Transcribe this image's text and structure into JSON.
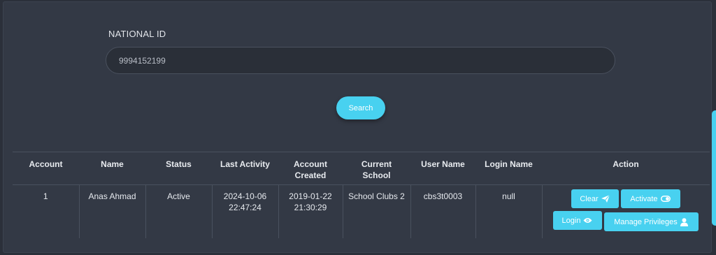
{
  "form": {
    "national_id_label": "NATIONAL ID",
    "national_id_value": "9994152199",
    "search_label": "Search"
  },
  "table": {
    "headers": {
      "account": "Account",
      "name": "Name",
      "status": "Status",
      "last_activity": "Last Activity",
      "account_created_1": "Account",
      "account_created_2": "Created",
      "current_school_1": "Current",
      "current_school_2": "School",
      "user_name": "User Name",
      "login_name": "Login Name",
      "action": "Action"
    },
    "rows": [
      {
        "account": "1",
        "name": "Anas Ahmad",
        "status": "Active",
        "last_activity_date": "2024-10-06",
        "last_activity_time": "22:47:24",
        "created_date": "2019-01-22",
        "created_time": "21:30:29",
        "current_school": "School Clubs 2",
        "user_name": "cbs3t0003",
        "login_name": "null"
      }
    ]
  },
  "actions": {
    "clear": "Clear",
    "activate": "Activate",
    "login": "Login",
    "manage_privileges": "Manage Privileges"
  },
  "icons": {
    "clear": "paper-plane-icon",
    "activate": "toggle-icon",
    "login": "eye-icon",
    "manage_privileges": "user-icon"
  },
  "colors": {
    "accent": "#48d1f0",
    "background": "#2b303a",
    "panel": "#333945"
  }
}
